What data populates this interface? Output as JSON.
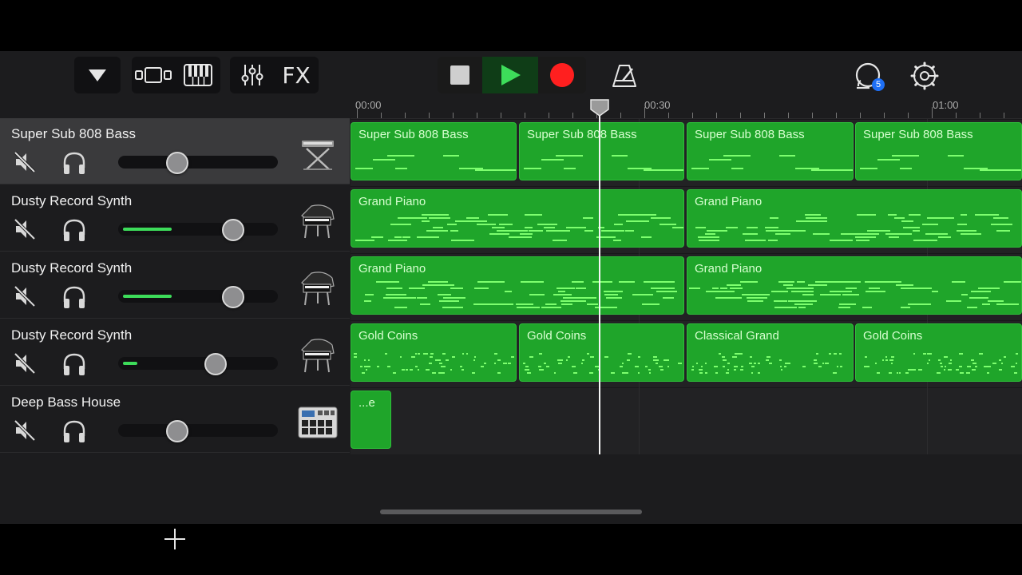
{
  "toolbar": {
    "fx_label": "FX",
    "badge_count": "5"
  },
  "ruler": {
    "markers": [
      "00:00",
      "00:30",
      "01:00"
    ]
  },
  "tracks": [
    {
      "name": "Super Sub 808 Bass",
      "volume": 0.37,
      "level": 0,
      "instrument_icon": "keyboard-stand-icon",
      "selected": true
    },
    {
      "name": "Dusty Record Synth",
      "volume": 0.72,
      "level": 0.31,
      "instrument_icon": "grand-piano-icon",
      "selected": false
    },
    {
      "name": "Dusty Record Synth",
      "volume": 0.72,
      "level": 0.31,
      "instrument_icon": "grand-piano-icon",
      "selected": false
    },
    {
      "name": "Dusty Record Synth",
      "volume": 0.61,
      "level": 0.09,
      "instrument_icon": "grand-piano-icon",
      "selected": false
    },
    {
      "name": "Deep Bass House",
      "volume": 0.37,
      "level": 0,
      "instrument_icon": "drum-machine-icon",
      "selected": false
    }
  ],
  "regions": {
    "track1": [
      "Super Sub 808 Bass",
      "Super Sub 808 Bass",
      "Super Sub 808 Bass",
      "Super Sub 808 Bass"
    ],
    "track2": [
      "Grand Piano",
      "Grand Piano"
    ],
    "track3": [
      "Grand Piano",
      "Grand Piano"
    ],
    "track4": [
      "Gold Coins",
      "Gold Coins",
      "Classical Grand",
      "Gold Coins"
    ],
    "track5": [
      "...e"
    ]
  },
  "colors": {
    "region": "#1fa52a",
    "play": "#3ddc5a",
    "record": "#ff1f1f",
    "badge": "#1e6ff5"
  }
}
